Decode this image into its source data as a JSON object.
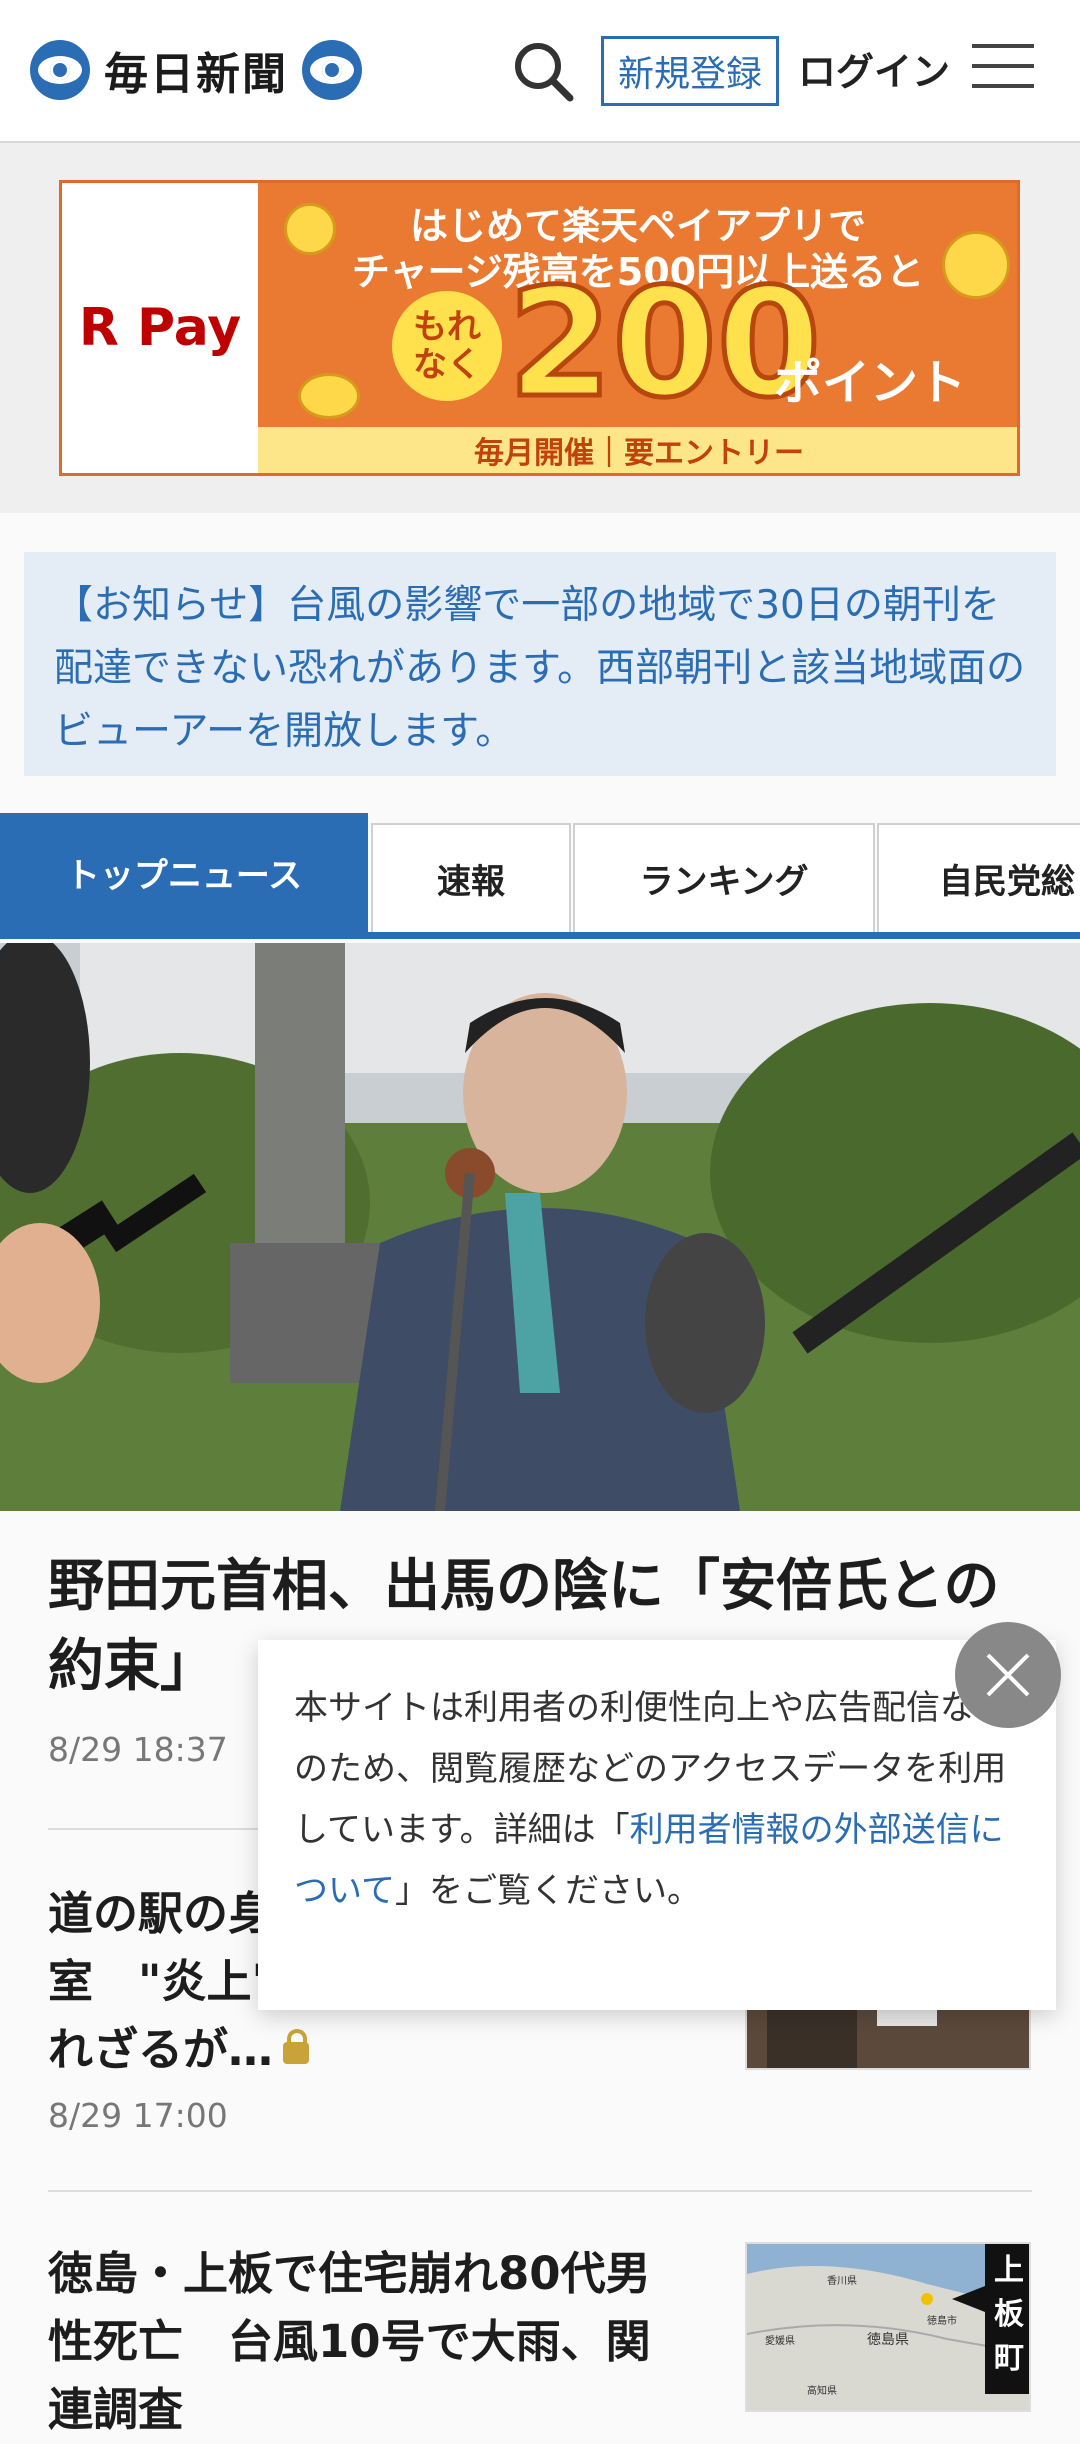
{
  "header": {
    "logo_text": "毎日新聞",
    "register_label": "新規登録",
    "login_label": "ログイン"
  },
  "ad": {
    "brand": "R Pay",
    "line1": "はじめて楽天ペイアプリで",
    "line2": "チャージ残高を500円以上送ると",
    "badge_top": "もれ",
    "badge_bottom": "なく",
    "big_number": "200",
    "points_label": "ポイント",
    "footer": "毎月開催｜要エントリー",
    "colors": {
      "bg": "#ea7a32",
      "accent": "#ffe14d"
    }
  },
  "notice": {
    "text": "【お知らせ】台風の影響で一部の地域で30日の朝刊を配達できない恐れがあります。西部朝刊と該当地域面のビューアーを開放します。"
  },
  "tabs": [
    {
      "label": "トップニュース"
    },
    {
      "label": "速報"
    },
    {
      "label": "ランキング"
    },
    {
      "label": "自民党総"
    }
  ],
  "articles": {
    "lead": {
      "title": "野田元首相、出馬の陰に「安倍氏との約束」",
      "time": "8/29 18:37"
    },
    "items": [
      {
        "title": "道の駅の身障者用トイレが倉庫室　\"炎上\"したが真相は？知られざるが…",
        "time": "8/29 17:00",
        "locked": true
      },
      {
        "title": "徳島・上板で住宅崩れ80代男性死亡　台風10号で大雨、関連調査",
        "thumb_label": "上板町"
      }
    ]
  },
  "map_labels": [
    "徳島県",
    "香川県",
    "愛媛県",
    "高知県",
    "徳島市"
  ],
  "cookie": {
    "text_before": "本サイトは利用者の利便性向上や広告配信などのため、閲覧履歴などのアクセスデータを利用しています。詳細は「",
    "link_text": "利用者情報の外部送信について",
    "text_after": "」をご覧ください。"
  },
  "theme": {
    "primary": "#2a6db5",
    "notice_bg": "#e4ecf5"
  },
  "icons": [
    "logo-emblem-icon",
    "search-icon",
    "menu-icon",
    "lock-icon",
    "close-icon"
  ]
}
